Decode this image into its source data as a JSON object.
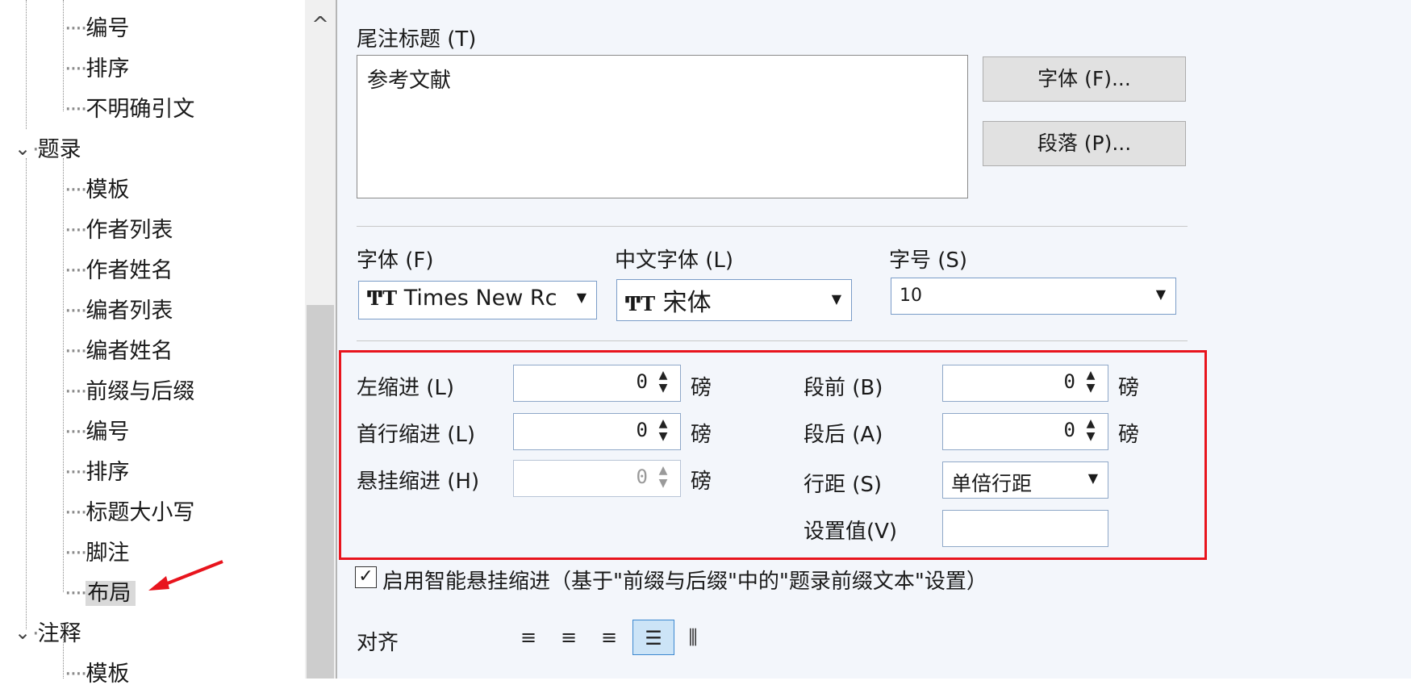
{
  "tree": {
    "items": [
      {
        "label": "编号",
        "level": 2
      },
      {
        "label": "排序",
        "level": 2
      },
      {
        "label": "不明确引文",
        "level": 2
      },
      {
        "label": "题录",
        "level": 1
      },
      {
        "label": "模板",
        "level": 2
      },
      {
        "label": "作者列表",
        "level": 2
      },
      {
        "label": "作者姓名",
        "level": 2
      },
      {
        "label": "编者列表",
        "level": 2
      },
      {
        "label": "编者姓名",
        "level": 2
      },
      {
        "label": "前缀与后缀",
        "level": 2
      },
      {
        "label": "编号",
        "level": 2
      },
      {
        "label": "排序",
        "level": 2
      },
      {
        "label": "标题大小写",
        "level": 2
      },
      {
        "label": "脚注",
        "level": 2
      },
      {
        "label": "布局",
        "level": 2,
        "selected": true
      },
      {
        "label": "注释",
        "level": 1
      },
      {
        "label": "模板",
        "level": 2
      }
    ],
    "selected_icon": "red-arrow-icon"
  },
  "endnote_title": {
    "label": "尾注标题 (T)",
    "value": "参考文献",
    "font_button": "字体 (F)...",
    "paragraph_button": "段落 (P)..."
  },
  "font": {
    "font_label": "字体 (F)",
    "font_value": "Times New Rc",
    "cn_font_label": "中文字体 (L)",
    "cn_font_value": "宋体",
    "size_label": "字号 (S)",
    "size_value": "10",
    "font_icon": "truetype-icon"
  },
  "indent": {
    "left_label": "左缩进 (L)",
    "left_value": "0",
    "first_label": "首行缩进 (L)",
    "first_value": "0",
    "hanging_label": "悬挂缩进 (H)",
    "hanging_value": "0",
    "unit": "磅"
  },
  "spacing": {
    "before_label": "段前 (B)",
    "before_value": "0",
    "after_label": "段后 (A)",
    "after_value": "0",
    "line_label": "行距 (S)",
    "line_value": "单倍行距",
    "setting_label": "设置值(V)",
    "setting_value": "",
    "unit": "磅"
  },
  "smart_hanging": {
    "checked": true,
    "label": "启用智能悬挂缩进（基于\"前缀与后缀\"中的\"题录前缀文本\"设置）"
  },
  "alignment": {
    "label": "对齐",
    "options": [
      "align-left-icon",
      "align-center-icon",
      "align-right-icon",
      "align-justify-icon",
      "align-distributed-icon"
    ],
    "active": "align-justify-icon"
  },
  "colors": {
    "highlight_frame": "#e8141d",
    "panel_bg": "#f3f6fb",
    "active_align": "#cce4f7"
  }
}
